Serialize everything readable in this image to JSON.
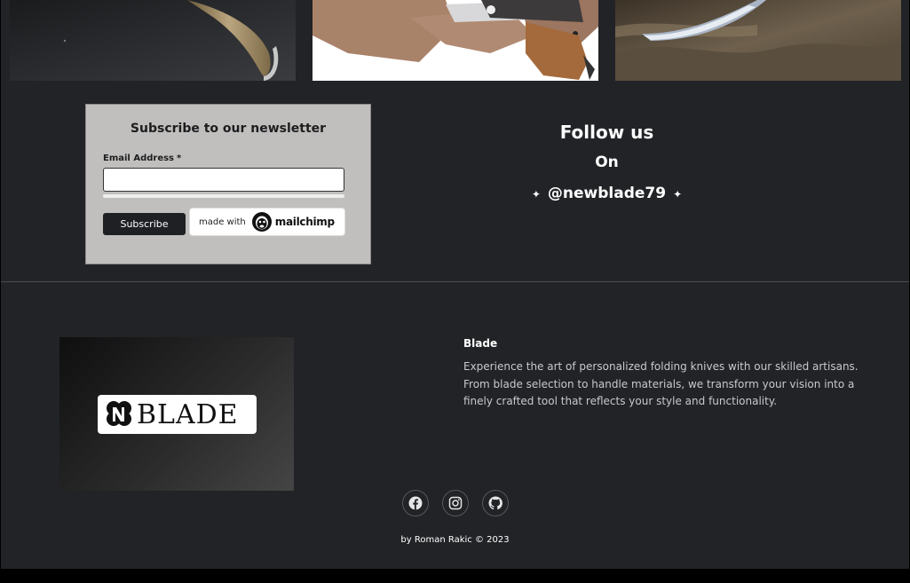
{
  "gallery": {
    "photos": [
      {
        "icon": "knife-photo-icon"
      },
      {
        "icon": "knife-on-burlap-photo-icon"
      },
      {
        "icon": "knife-on-wood-photo-icon"
      }
    ]
  },
  "newsletter": {
    "title": "Subscribe to our newsletter",
    "email_label": "Email Address",
    "required_mark": "*",
    "email_value": "",
    "subscribe_label": "Subscribe",
    "badge_made_with": "made with",
    "badge_brand": "mailchimp"
  },
  "follow": {
    "title": "Follow us",
    "on": "On",
    "handle": "@newblade79",
    "sparkle": "✦"
  },
  "footer": {
    "logo_text": "BLADE",
    "brand_title": "Blade",
    "brand_description": "Experience the art of personalized folding knives with our skilled artisans. From blade selection to handle materials, we transform your vision into a finely crafted tool that reflects your style and functionality.",
    "socials": [
      {
        "name": "facebook-icon"
      },
      {
        "name": "instagram-icon"
      },
      {
        "name": "github-icon"
      }
    ],
    "credit": "by Roman Rakic © 2023"
  },
  "colors": {
    "background": "#212326",
    "newsletter_bg": "#c1bfbd",
    "button_bg": "#1f2023",
    "text_light": "#ffffff",
    "text_muted": "#c9c9cb"
  }
}
